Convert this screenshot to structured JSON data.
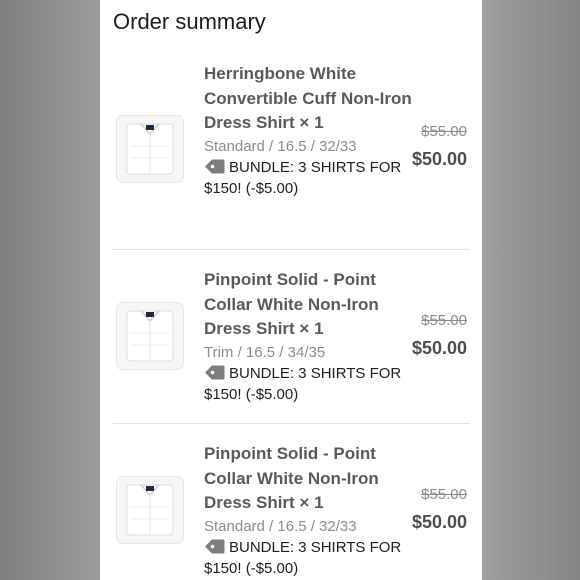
{
  "summary": {
    "title": "Order summary"
  },
  "items": [
    {
      "title": "Herringbone White Convertible Cuff Non-Iron Dress Shirt × 1",
      "variant": "Standard / 16.5 / 32/33",
      "discount": "BUNDLE: 3 SHIRTS FOR $150! (-$5.00)",
      "original_price": "$55.00",
      "price": "$50.00",
      "icons": {
        "tag": "tag-icon",
        "image": "shirt-thumbnail"
      }
    },
    {
      "title": "Pinpoint Solid - Point Collar White Non-Iron Dress Shirt × 1",
      "variant": "Trim / 16.5 / 34/35",
      "discount": "BUNDLE: 3 SHIRTS FOR $150! (-$5.00)",
      "original_price": "$55.00",
      "price": "$50.00",
      "icons": {
        "tag": "tag-icon",
        "image": "shirt-thumbnail"
      }
    },
    {
      "title": "Pinpoint Solid - Point Collar White Non-Iron Dress Shirt × 1",
      "variant": "Standard / 16.5 / 32/33",
      "discount": "BUNDLE: 3 SHIRTS FOR $150! (-$5.00)",
      "original_price": "$55.00",
      "price": "$50.00",
      "icons": {
        "tag": "tag-icon",
        "image": "shirt-thumbnail"
      }
    }
  ],
  "colors": {
    "panel_bg": "#ffffff",
    "backdrop": "#8f8f8f",
    "title_text": "#5a5a5a",
    "muted_text": "#8c8c8c",
    "divider": "#e3e3e3"
  }
}
